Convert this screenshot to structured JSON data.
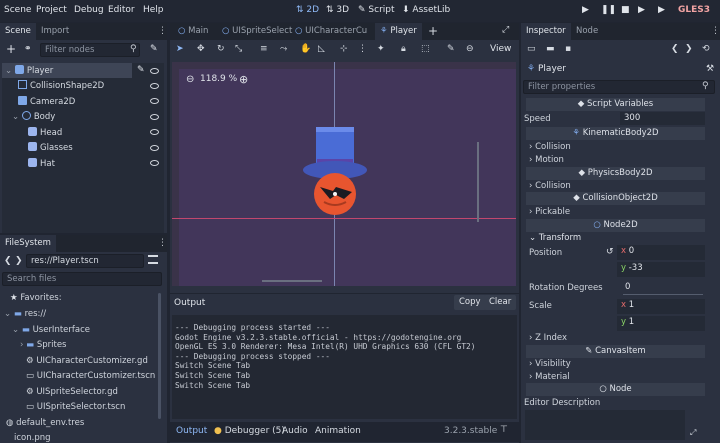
{
  "menu": {
    "scene": "Scene",
    "project": "Project",
    "debug": "Debug",
    "editor": "Editor",
    "help": "Help"
  },
  "workspaces": {
    "w2d": "2D",
    "w3d": "3D",
    "script": "Script",
    "assetlib": "AssetLib"
  },
  "renderer": "GLES3",
  "scene_dock": {
    "tabs": {
      "scene": "Scene",
      "import": "Import"
    },
    "filter_placeholder": "Filter nodes",
    "nodes": [
      "Player",
      "CollisionShape2D",
      "Camera2D",
      "Body",
      "Head",
      "Glasses",
      "Hat"
    ]
  },
  "filesystem": {
    "title": "FileSystem",
    "path": "res://Player.tscn",
    "search_placeholder": "Search files",
    "favorites": "Favorites:",
    "items": [
      "res://",
      "UserInterface",
      "Sprites",
      "UICharacterCustomizer.gd",
      "UICharacterCustomizer.tscn",
      "UISpriteSelector.gd",
      "UISpriteSelector.tscn",
      "default_env.tres",
      "icon.png"
    ]
  },
  "editor_tabs": [
    "Main",
    "UISpriteSelect",
    "UICharacterCu",
    "Player"
  ],
  "toolbar": {
    "view": "View",
    "zoom": "118.9 %"
  },
  "output": {
    "title": "Output",
    "copy": "Copy",
    "clear": "Clear",
    "lines": [
      "--- Debugging process started ---",
      "Godot Engine v3.2.3.stable.official - https://godotengine.org",
      "OpenGL ES 3.0 Renderer: Mesa Intel(R) UHD Graphics 630 (CFL GT2)",
      "",
      "--- Debugging process stopped ---",
      "Switch Scene Tab",
      "Switch Scene Tab",
      "Switch Scene Tab"
    ],
    "bottom_tabs": {
      "output": "Output",
      "debugger": "Debugger (5)",
      "audio": "Audio",
      "animation": "Animation"
    },
    "version": "3.2.3.stable"
  },
  "inspector": {
    "tabs": {
      "inspector": "Inspector",
      "node": "Node"
    },
    "object": "Player",
    "filter_placeholder": "Filter properties",
    "script_vars": "Script Variables",
    "speed_label": "Speed",
    "speed_value": "300",
    "kinematic": "KinematicBody2D",
    "collision": "Collision",
    "motion": "Motion",
    "physics": "PhysicsBody2D",
    "collision2": "Collision",
    "collobj": "CollisionObject2D",
    "pickable": "Pickable",
    "node2d": "Node2D",
    "transform": "Transform",
    "position": "Position",
    "pos_x": "0",
    "pos_y": "-33",
    "rotation": "Rotation Degrees",
    "rot_value": "0",
    "scale": "Scale",
    "scale_x": "1",
    "scale_y": "1",
    "zindex": "Z Index",
    "canvasitem": "CanvasItem",
    "visibility": "Visibility",
    "material": "Material",
    "node": "Node",
    "editor_desc": "Editor Description"
  }
}
